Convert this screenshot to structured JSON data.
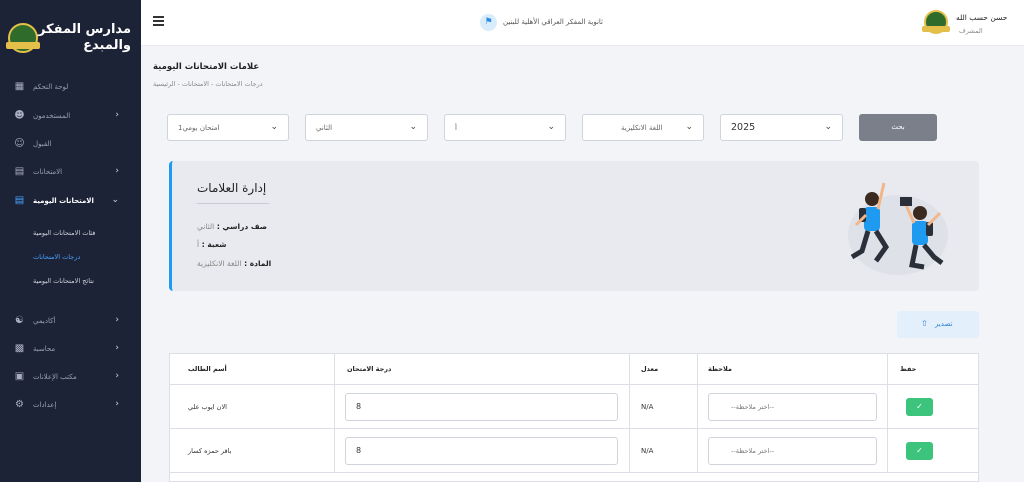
{
  "sidebar": {
    "brand": "مدارس المفكر والمبدع",
    "items": [
      {
        "label": "لوحة التحكم",
        "icon": "dashboard-icon"
      },
      {
        "label": "المستخدمون",
        "icon": "users-icon"
      },
      {
        "label": "القبول",
        "icon": "user-plus-icon"
      },
      {
        "label": "الامتحانات",
        "icon": "document-icon"
      },
      {
        "label": "الامتحانات اليومية",
        "icon": "document-icon"
      },
      {
        "label": "أكاديمي",
        "icon": "academic-icon"
      },
      {
        "label": "محاسبة",
        "icon": "accounting-icon"
      },
      {
        "label": "مكتب الإعلانات",
        "icon": "briefcase-icon"
      },
      {
        "label": "إعدادات",
        "icon": "gear-icon"
      }
    ],
    "sub_items": [
      "فئات الامتحانات اليومية",
      "درجات الامتحانات",
      "نتائج الامتحانات اليومية"
    ]
  },
  "topbar": {
    "school_name": "ثانوية المفكر العراقي الأهلية للبنين",
    "user_name": "حسن حسب الله",
    "user_role": "المشرف"
  },
  "page": {
    "title": "علامات الامتحانات اليومية",
    "breadcrumb": "درجات الامتحانات - الامتحانات - الرئيسية"
  },
  "filters": {
    "exam": "امتحان يومي1",
    "grade": "الثاني",
    "section": "أ",
    "subject": "اللغة الانكليزية",
    "year": "2025",
    "search_label": "بحث"
  },
  "card": {
    "title": "إدارة العلامات",
    "grade_label": "صف دراسي :",
    "grade_value": "الثاني",
    "section_label": "شعبة :",
    "section_value": "أ",
    "subject_label": "المادة :",
    "subject_value": "اللغة الانكليزية"
  },
  "export_label": "تصدير",
  "table": {
    "headers": {
      "student": "أسم الطالب",
      "grade": "درجة الامتحان",
      "average": "معدل",
      "note": "ملاحظة",
      "save": "حفظ"
    },
    "rows": [
      {
        "student": "الان ايوب علي",
        "grade": "8",
        "average": "N/A",
        "note": "--اختر ملاحظة--"
      },
      {
        "student": "باقر حمزه كسار",
        "grade": "8",
        "average": "N/A",
        "note": "--اختر ملاحظة--"
      }
    ]
  },
  "colors": {
    "sidebar_bg": "#1d2337",
    "accent": "#1e9bf0",
    "save_green": "#3cc47c",
    "search_grey": "#7a7f8a"
  }
}
